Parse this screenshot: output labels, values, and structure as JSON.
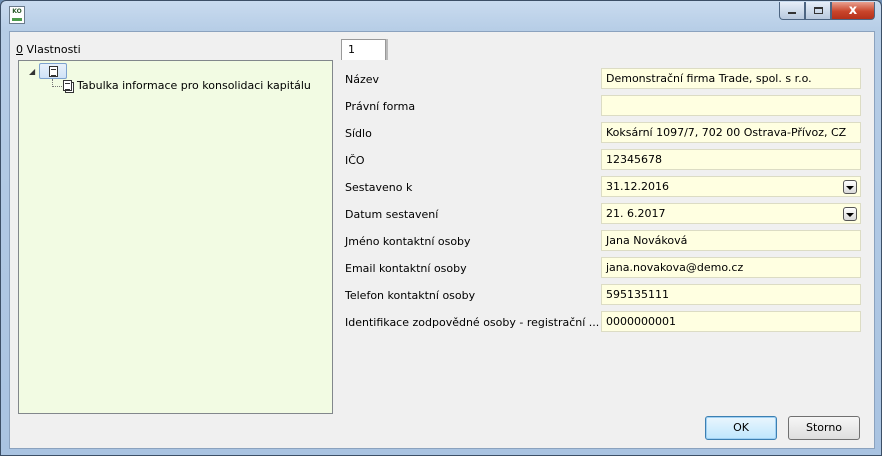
{
  "window": {
    "app_icon_text": "KO",
    "close_glyph": "x"
  },
  "tree": {
    "label_mnemonic": "0",
    "label_text": " Vlastnosti",
    "child_label": "Tabulka informace pro konsolidaci kapitálu"
  },
  "tab": {
    "label": "1"
  },
  "form": {
    "fields": [
      {
        "label": "Název",
        "value": "Demonstrační firma Trade, spol. s r.o.",
        "dropdown": false
      },
      {
        "label": "Právní forma",
        "value": "",
        "dropdown": false
      },
      {
        "label": "Sídlo",
        "value": "Koksární 1097/7, 702 00 Ostrava-Přívoz, CZ",
        "dropdown": false
      },
      {
        "label": "IČO",
        "value": "12345678",
        "dropdown": false
      },
      {
        "label": "Sestaveno k",
        "value": "31.12.2016",
        "dropdown": true
      },
      {
        "label": "Datum sestavení",
        "value": "21. 6.2017",
        "dropdown": true
      },
      {
        "label": "Jméno kontaktní osoby",
        "value": "Jana Nováková",
        "dropdown": false
      },
      {
        "label": "Email kontaktní osoby",
        "value": "jana.novakova@demo.cz",
        "dropdown": false
      },
      {
        "label": "Telefon kontaktní osoby",
        "value": "595135111",
        "dropdown": false
      },
      {
        "label": "Identifikace zodpovědné osoby - registrační ...",
        "value": "0000000001",
        "dropdown": false
      }
    ]
  },
  "buttons": {
    "ok": "OK",
    "cancel": "Storno"
  },
  "colors": {
    "field_background": "#ffffe1",
    "tree_background": "#f2fbe3"
  }
}
